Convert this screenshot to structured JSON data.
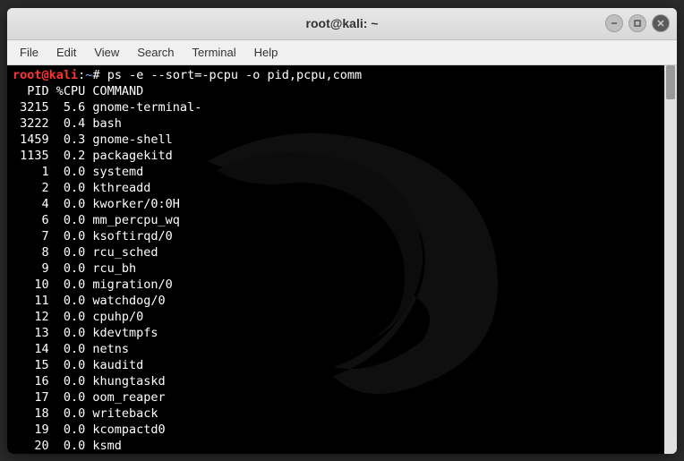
{
  "window": {
    "title": "root@kali: ~"
  },
  "menubar": {
    "items": [
      "File",
      "Edit",
      "View",
      "Search",
      "Terminal",
      "Help"
    ]
  },
  "prompt": {
    "user": "root@kali",
    "sep": ":",
    "path": "~",
    "symbol": "#",
    "command": "ps -e --sort=-pcpu -o pid,pcpu,comm"
  },
  "output": {
    "header": "  PID %CPU COMMAND",
    "rows": [
      {
        "pid": "3215",
        "pcpu": "5.6",
        "comm": "gnome-terminal-"
      },
      {
        "pid": "3222",
        "pcpu": "0.4",
        "comm": "bash"
      },
      {
        "pid": "1459",
        "pcpu": "0.3",
        "comm": "gnome-shell"
      },
      {
        "pid": "1135",
        "pcpu": "0.2",
        "comm": "packagekitd"
      },
      {
        "pid": "1",
        "pcpu": "0.0",
        "comm": "systemd"
      },
      {
        "pid": "2",
        "pcpu": "0.0",
        "comm": "kthreadd"
      },
      {
        "pid": "4",
        "pcpu": "0.0",
        "comm": "kworker/0:0H"
      },
      {
        "pid": "6",
        "pcpu": "0.0",
        "comm": "mm_percpu_wq"
      },
      {
        "pid": "7",
        "pcpu": "0.0",
        "comm": "ksoftirqd/0"
      },
      {
        "pid": "8",
        "pcpu": "0.0",
        "comm": "rcu_sched"
      },
      {
        "pid": "9",
        "pcpu": "0.0",
        "comm": "rcu_bh"
      },
      {
        "pid": "10",
        "pcpu": "0.0",
        "comm": "migration/0"
      },
      {
        "pid": "11",
        "pcpu": "0.0",
        "comm": "watchdog/0"
      },
      {
        "pid": "12",
        "pcpu": "0.0",
        "comm": "cpuhp/0"
      },
      {
        "pid": "13",
        "pcpu": "0.0",
        "comm": "kdevtmpfs"
      },
      {
        "pid": "14",
        "pcpu": "0.0",
        "comm": "netns"
      },
      {
        "pid": "15",
        "pcpu": "0.0",
        "comm": "kauditd"
      },
      {
        "pid": "16",
        "pcpu": "0.0",
        "comm": "khungtaskd"
      },
      {
        "pid": "17",
        "pcpu": "0.0",
        "comm": "oom_reaper"
      },
      {
        "pid": "18",
        "pcpu": "0.0",
        "comm": "writeback"
      },
      {
        "pid": "19",
        "pcpu": "0.0",
        "comm": "kcompactd0"
      },
      {
        "pid": "20",
        "pcpu": "0.0",
        "comm": "ksmd"
      }
    ]
  }
}
